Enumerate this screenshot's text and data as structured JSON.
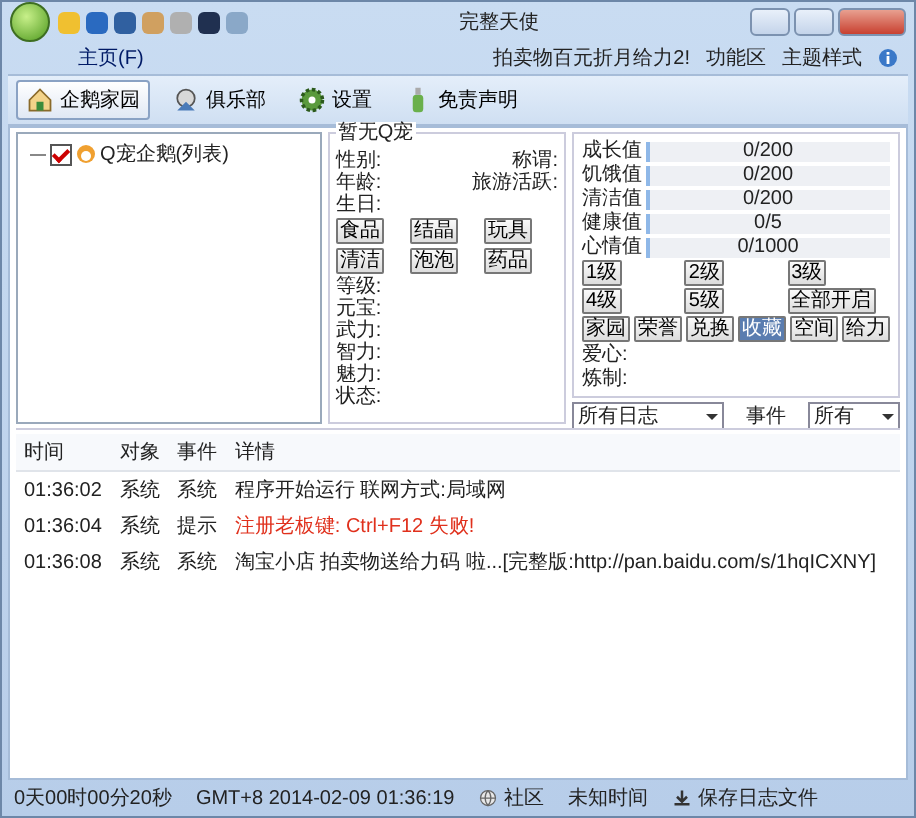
{
  "window": {
    "title": "完整天使"
  },
  "ribbon": {
    "tabs": [
      {
        "label": "主页(F)",
        "selected": true
      }
    ],
    "links": [
      "拍卖物百元折月给力2!",
      "功能区",
      "主题样式"
    ]
  },
  "toolbar": [
    {
      "label": "企鹅家园",
      "selected": true
    },
    {
      "label": "俱乐部",
      "selected": false
    },
    {
      "label": "设置",
      "selected": false
    },
    {
      "label": "免责声明",
      "selected": false
    }
  ],
  "tree": {
    "items": [
      {
        "label": "Q宠企鹅(列表)",
        "checked": true
      }
    ]
  },
  "pet": {
    "title": "暂无Q宠",
    "rows": [
      {
        "label": "性别:",
        "label2": "称谓:"
      },
      {
        "label": "年龄:",
        "label2": "旅游活跃:"
      },
      {
        "label": "生日:"
      }
    ],
    "buttons": [
      [
        "食品",
        "结晶",
        "玩具"
      ],
      [
        "清洁",
        "泡泡",
        "药品"
      ]
    ],
    "fields": [
      "等级:",
      "元宝:",
      "武力:",
      "智力:",
      "魅力:",
      "状态:"
    ]
  },
  "stats": [
    {
      "label": "成长值",
      "reading": "0/200",
      "level": 0.02
    },
    {
      "label": "饥饿值",
      "reading": "0/200",
      "level": 0.02
    },
    {
      "label": "清洁值",
      "reading": "0/200",
      "level": 0.02
    },
    {
      "label": "健康值",
      "reading": "0/5",
      "level": 0.02
    },
    {
      "label": "心情值",
      "reading": "0/1000",
      "level": 0.02
    }
  ],
  "levels": [
    [
      "1级",
      "2级",
      "3级"
    ],
    [
      "4级",
      "5级",
      "全部开启"
    ]
  ],
  "actions": [
    {
      "label": "家园",
      "selected": false
    },
    {
      "label": "荣誉",
      "selected": false
    },
    {
      "label": "兑换",
      "selected": false
    },
    {
      "label": "收藏",
      "selected": true
    },
    {
      "label": "空间",
      "selected": false
    },
    {
      "label": "给力",
      "selected": false
    }
  ],
  "extra_fields": [
    "爱心:",
    "炼制:"
  ],
  "filters": {
    "log": "所有日志",
    "event_label": "事件",
    "event": "所有"
  },
  "log": {
    "columns": [
      "时间",
      "对象",
      "事件",
      "详情"
    ],
    "rows": [
      {
        "time": "01:36:02",
        "object": "系统",
        "event": "系统",
        "detail": "程序开始运行 联网方式:局域网",
        "kind": "normal"
      },
      {
        "time": "01:36:04",
        "object": "系统",
        "event": "提示",
        "detail": "注册老板键: Ctrl+F12 失败!",
        "kind": "error"
      },
      {
        "time": "01:36:08",
        "object": "系统",
        "event": "系统",
        "detail": "淘宝小店 拍卖物送给力码 啦...[完整版:http://pan.baidu.com/s/1hqICXNY]",
        "kind": "normal"
      }
    ]
  },
  "status_bar": [
    "0天00时00分20秒",
    "GMT+8 2014-02-09 01:36:19",
    "社区",
    "未知时间",
    "保存日志文件"
  ]
}
